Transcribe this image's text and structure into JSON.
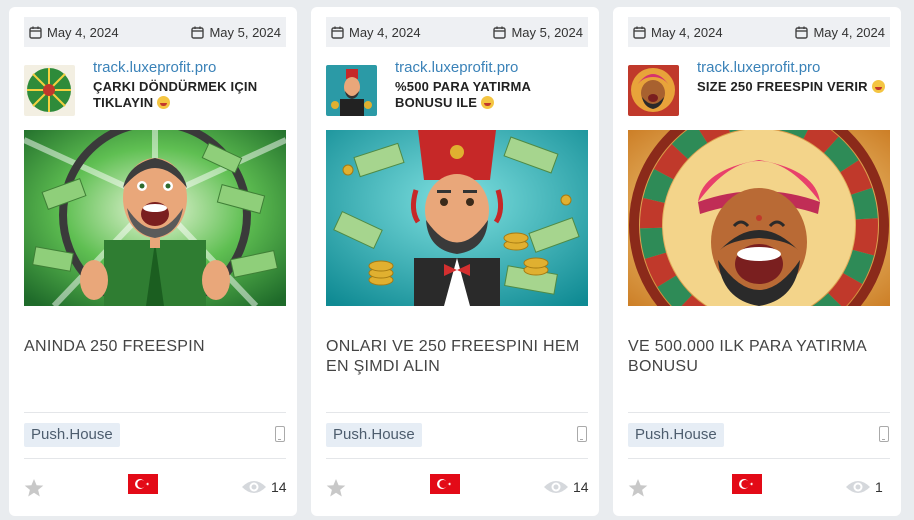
{
  "cards": [
    {
      "start_date": "May 4, 2024",
      "end_date": "May 5, 2024",
      "domain": "track.luxeprofit.pro",
      "title": "ÇARKI DÖNDÜRMEK IÇIN TIKLAYIN",
      "description": "ANINDA 250 FREESPIN",
      "network": "Push.House",
      "views": "14",
      "device": "mobile-icon",
      "country_flag": "turkey-flag-icon"
    },
    {
      "start_date": "May 4, 2024",
      "end_date": "May 5, 2024",
      "domain": "track.luxeprofit.pro",
      "title": "%500 PARA YATIRMA BONUSU ILE",
      "description": "ONLARI VE 250 FREESPINI HEM EN ŞIMDI ALIN",
      "network": "Push.House",
      "views": "14",
      "device": "mobile-icon",
      "country_flag": "turkey-flag-icon"
    },
    {
      "start_date": "May 4, 2024",
      "end_date": "May 4, 2024",
      "domain": "track.luxeprofit.pro",
      "title": "SIZE 250 FREESPIN VERIR",
      "description": "VE 500.000 ILK PARA YATIRMA BONUSU",
      "network": "Push.House",
      "views": "1",
      "device": "mobile-icon",
      "country_flag": "turkey-flag-icon"
    }
  ],
  "colors": {
    "link": "#3a82b8",
    "tag_bg": "#e6edf5",
    "page_bg": "#e9ecef"
  }
}
